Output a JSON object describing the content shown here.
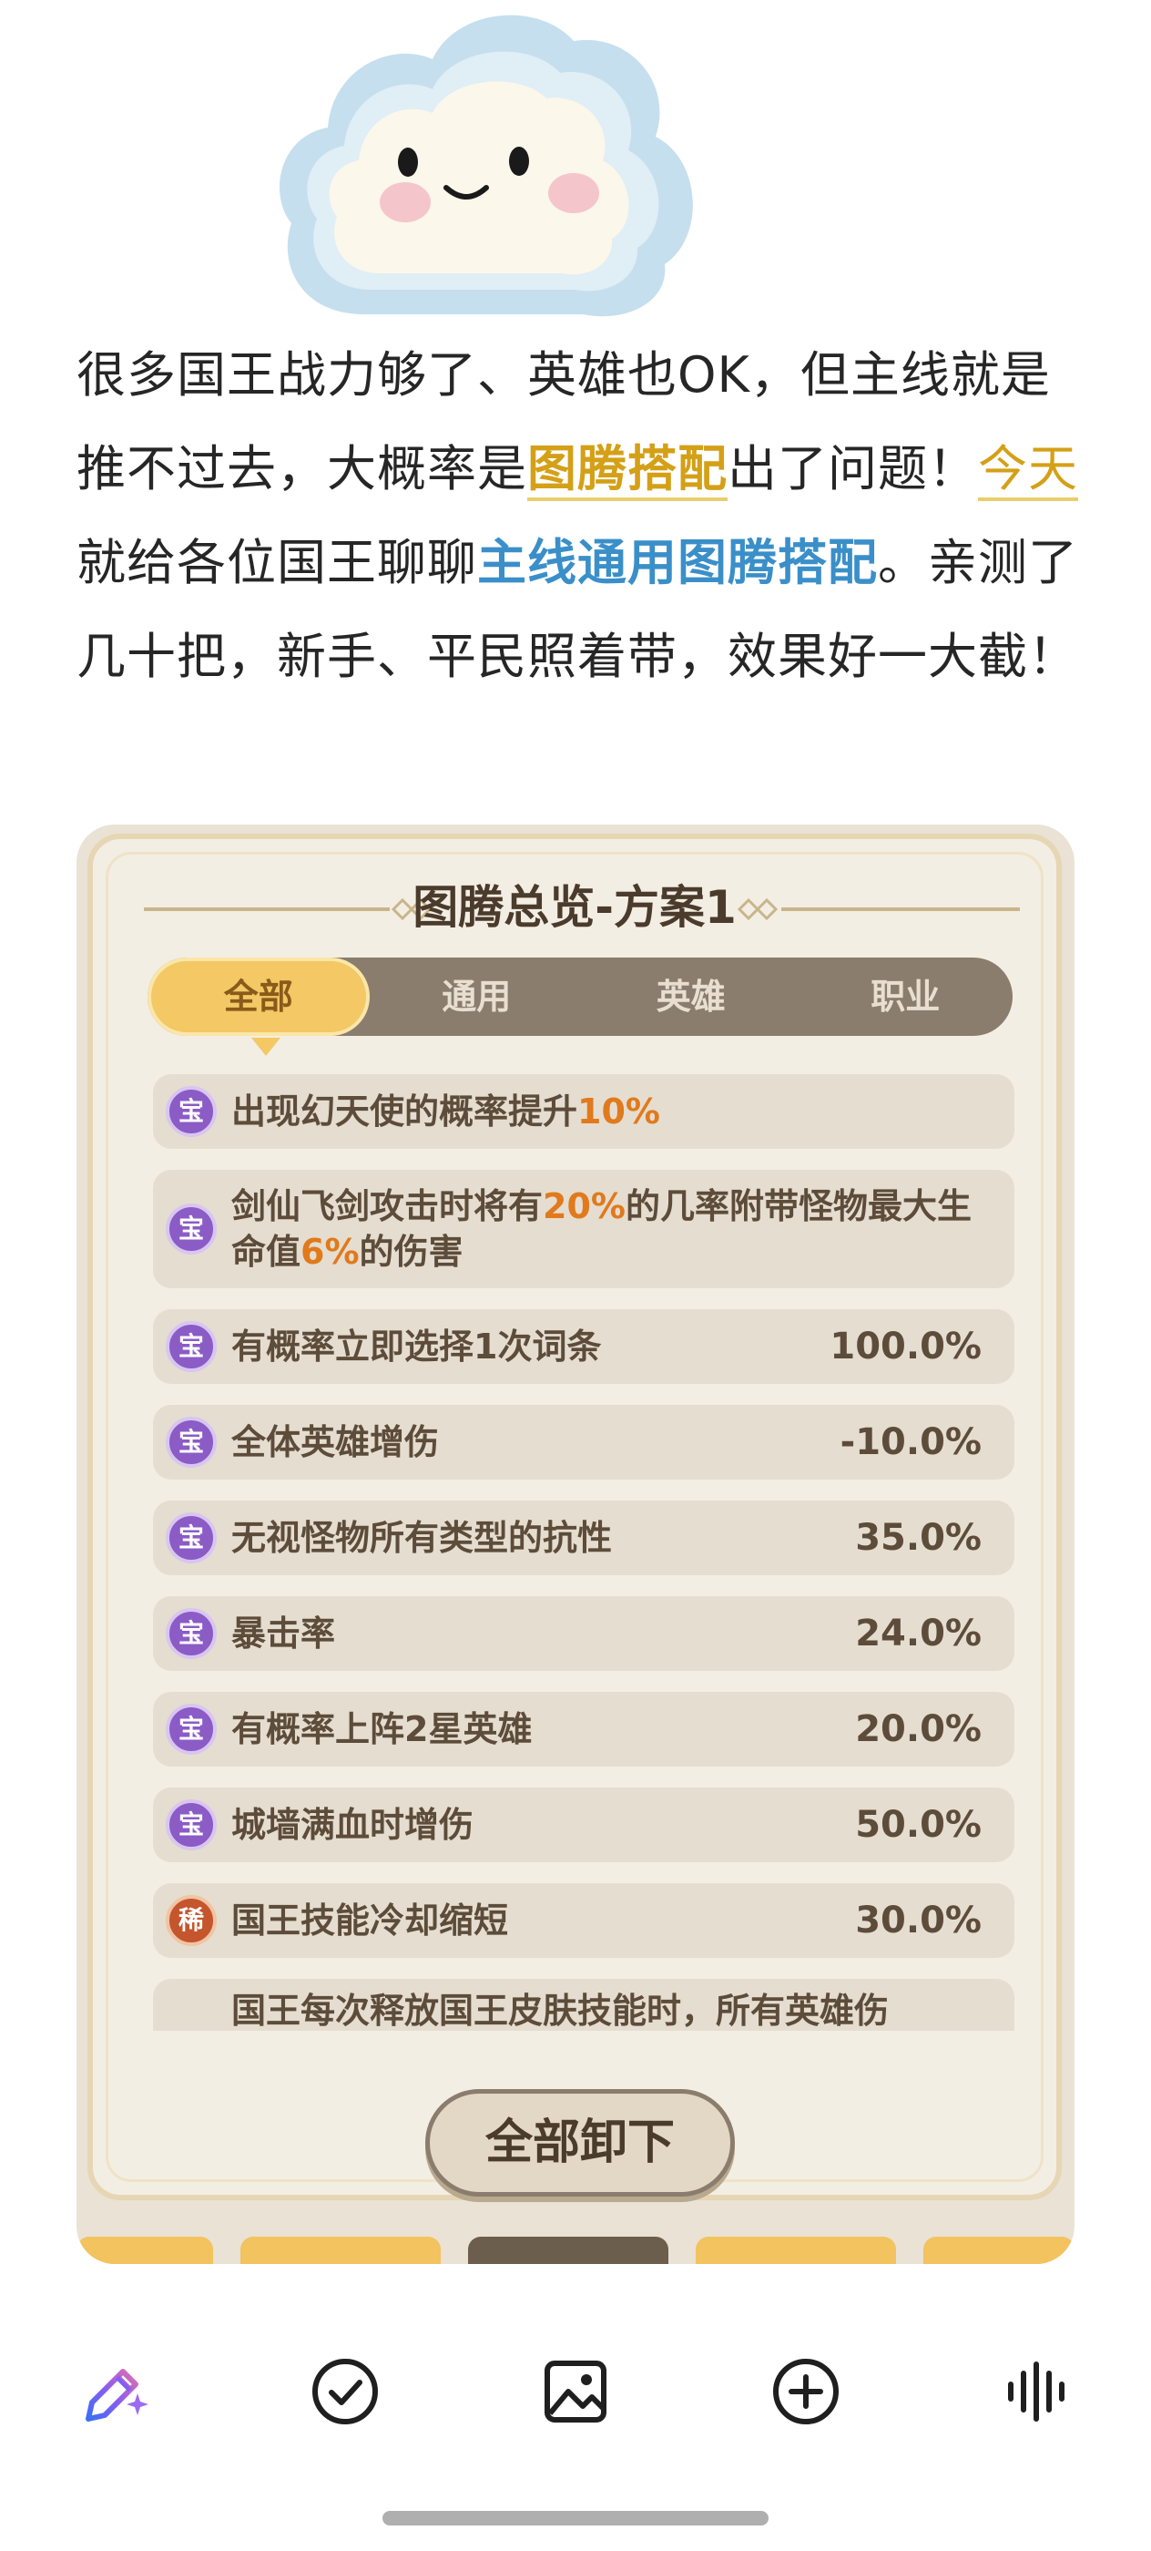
{
  "article": {
    "p1": "很多国王战力够了、英雄也OK，但主线就是推不过去，大概率是",
    "hl1": "图腾搭配",
    "p2": "出了问题！",
    "link": "今天",
    "p3": "就给各位国王聊聊",
    "hl2": "主线通用图腾搭配",
    "p4": "。亲测了几十把，新手、平民照着带，效果好一大截！"
  },
  "game": {
    "title": "图腾总览-方案1",
    "tabs": [
      "全部",
      "通用",
      "英雄",
      "职业"
    ],
    "rows": [
      {
        "badge": "宝",
        "pre": "出现幻天使的概率提升",
        "num": "10%",
        "post": "",
        "value": ""
      },
      {
        "badge": "宝",
        "pre": "剑仙飞剑攻击时将有",
        "num": "20%",
        "mid": "的几率附带怪物最大生命值",
        "num2": "6%",
        "post": "的伤害",
        "value": ""
      },
      {
        "badge": "宝",
        "text": "有概率立即选择1次词条",
        "value": "100.0%"
      },
      {
        "badge": "宝",
        "text": "全体英雄增伤",
        "value": "-10.0%"
      },
      {
        "badge": "宝",
        "text": "无视怪物所有类型的抗性",
        "value": "35.0%"
      },
      {
        "badge": "宝",
        "text": "暴击率",
        "value": "24.0%"
      },
      {
        "badge": "宝",
        "text": "有概率上阵2星英雄",
        "value": "20.0%"
      },
      {
        "badge": "宝",
        "text": "城墙满血时增伤",
        "value": "50.0%"
      },
      {
        "badge": "稀",
        "text": "国王技能冷却缩短",
        "value": "30.0%"
      },
      {
        "badge": "",
        "text": "国王每次释放国王皮肤技能时，所有英雄伤",
        "value": ""
      }
    ],
    "unload_button": "全部卸下"
  },
  "toolbar": {
    "icons": [
      "ai-pen-icon",
      "check-circle-icon",
      "image-icon",
      "add-circle-icon",
      "voice-wave-icon"
    ]
  },
  "colors": {
    "highlight_yellow": "#d4a017",
    "highlight_blue": "#3a8fc9",
    "accent_orange": "#e07a1c",
    "badge_purple": "#8b5bc6",
    "badge_red": "#c4552c"
  }
}
